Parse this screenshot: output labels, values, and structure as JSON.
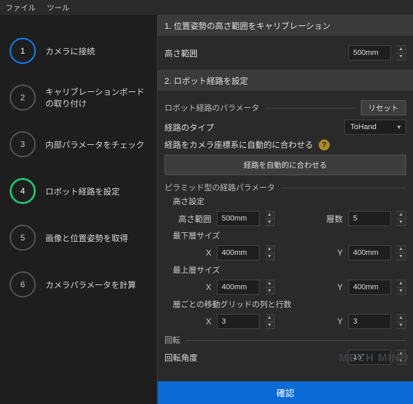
{
  "menu": {
    "file": "ファイル",
    "tools": "ツール"
  },
  "steps": [
    {
      "num": "1",
      "label": "カメラに接続"
    },
    {
      "num": "2",
      "label": "キャリブレーションボードの取り付け"
    },
    {
      "num": "3",
      "label": "内部パラメータをチェック"
    },
    {
      "num": "4",
      "label": "ロボット経路を設定"
    },
    {
      "num": "5",
      "label": "画像と位置姿勢を取得"
    },
    {
      "num": "6",
      "label": "カメラパラメータを計算"
    }
  ],
  "section1": {
    "title": "1. 位置姿勢の高さ範囲をキャリブレーション",
    "height_range_label": "高さ範囲",
    "height_range_value": "500mm"
  },
  "section2": {
    "title": "2. ロボット経路を設定",
    "params_group": "ロボット経路のパラメータ",
    "reset": "リセット",
    "route_type_label": "経路のタイプ",
    "route_type_value": "ToHand",
    "auto_fit_label": "経路をカメラ座標系に自動的に合わせる",
    "auto_fit_button": "経路を自動的に合わせる",
    "pyramid_group": "ピラミッド型の経路パラメータ",
    "height_setting": "高さ設定",
    "height_range_label": "高さ範囲",
    "height_range_value": "500mm",
    "layers_label": "層数",
    "layers_value": "5",
    "bottom_size_label": "最下層サイズ",
    "bottom_x": "400mm",
    "bottom_y": "400mm",
    "top_size_label": "最上層サイズ",
    "top_x": "400mm",
    "top_y": "400mm",
    "grid_label": "層ごとの移動グリッドの列と行数",
    "grid_x": "3",
    "grid_y": "3",
    "rotation_group": "回転",
    "rotation_angle_label": "回転角度",
    "rotation_angle_value": "15°",
    "x_label": "X",
    "y_label": "Y"
  },
  "confirm": "確認",
  "watermark": "MECH MIND"
}
